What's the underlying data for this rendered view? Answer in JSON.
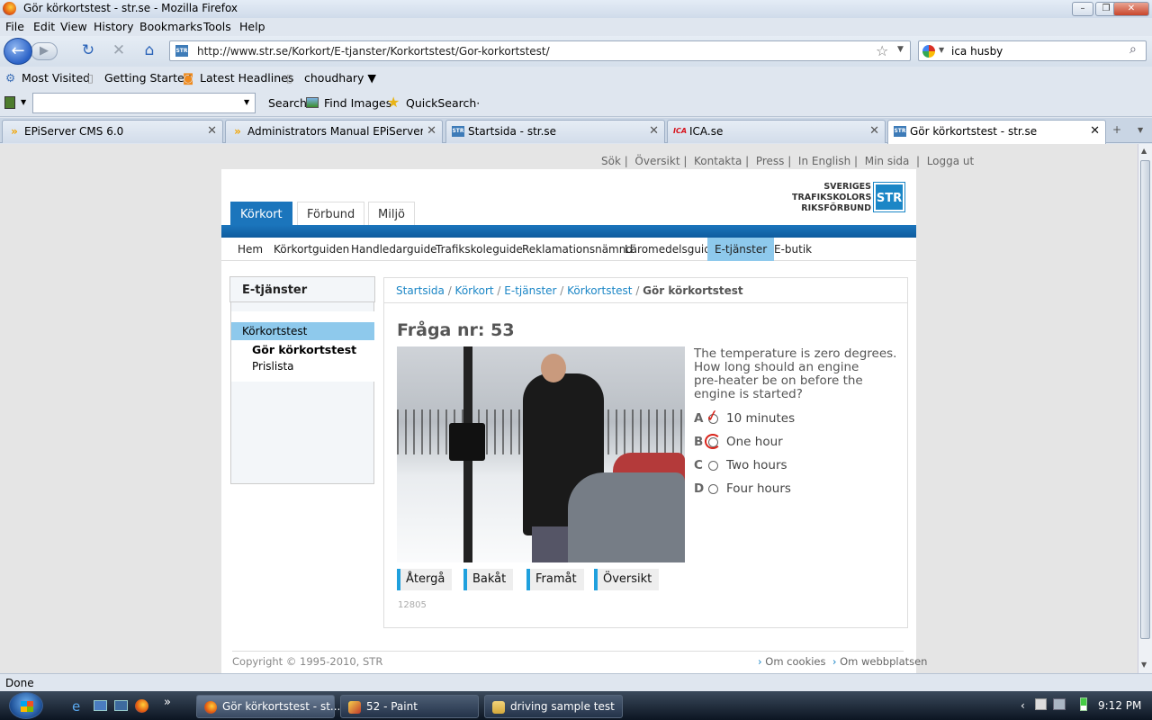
{
  "window": {
    "title": "Gör körkortstest - str.se - Mozilla Firefox"
  },
  "menu": [
    "File",
    "Edit",
    "View",
    "History",
    "Bookmarks",
    "Tools",
    "Help"
  ],
  "url": "http://www.str.se/Korkort/E-tjanster/Korkortstest/Gor-korkortstest/",
  "search": {
    "value": "ica husby"
  },
  "bookmarks": [
    "Most Visited",
    "Getting Started",
    "Latest Headlines",
    "choudhary ▼"
  ],
  "toolbar": {
    "search_label": "Search",
    "find_images": "Find Images",
    "quicksearch": "QuickSearch·"
  },
  "tabs": [
    {
      "label": "EPiServer CMS 6.0"
    },
    {
      "label": "Administrators Manual EPiServer C..."
    },
    {
      "label": "Startsida - str.se"
    },
    {
      "label": "ICA.se"
    },
    {
      "label": "Gör körkortstest - str.se"
    }
  ],
  "site": {
    "toplinks": [
      "Sök",
      "Översikt",
      "Kontakta",
      "Press",
      "In English",
      "Min sida",
      "Logga ut"
    ],
    "logo": [
      "SVERIGES",
      "TRAFIKSKOLORS",
      "RIKSFÖRBUND",
      "STR"
    ],
    "main_tabs": [
      "Körkort",
      "Förbund",
      "Miljö"
    ],
    "subnav": [
      "Hem",
      "Körkortguiden",
      "Handledarguide",
      "Trafikskoleguide",
      "Reklamationsnämnd",
      "Läromedelsguide",
      "E-tjänster",
      "E-butik"
    ],
    "left": {
      "heading": "E-tjänster",
      "items": [
        "Körkortstest",
        "Gör körkortstest",
        "Prislista"
      ]
    },
    "breadcrumb": [
      "Startsida",
      "Körkort",
      "E-tjänster",
      "Körkortstest",
      "Gör körkortstest"
    ],
    "question_title": "Fråga nr: 53",
    "question_text": [
      "The temperature is zero degrees.",
      "How long should an engine",
      "pre-heater be on before the",
      "engine is started?"
    ],
    "answers": [
      {
        "letter": "A",
        "text": "10 minutes"
      },
      {
        "letter": "B",
        "text": "One hour"
      },
      {
        "letter": "C",
        "text": "Two hours"
      },
      {
        "letter": "D",
        "text": "Four hours"
      }
    ],
    "buttons": [
      "Återgå",
      "Bakåt",
      "Framåt",
      "Översikt"
    ],
    "code": "12805",
    "copyright": "Copyright © 1995-2010, STR",
    "footer_links": [
      "Om cookies",
      "Om webbplatsen"
    ]
  },
  "status": "Done",
  "taskbar": {
    "items": [
      "Gör körkortstest - st...",
      "52 - Paint",
      "driving sample test"
    ],
    "clock": "9:12 PM"
  },
  "colors": {
    "brand_blue": "#1b75bc",
    "link": "#1b86c6",
    "selected_nav": "#8ec9ec",
    "markup_red": "#d9241b"
  }
}
